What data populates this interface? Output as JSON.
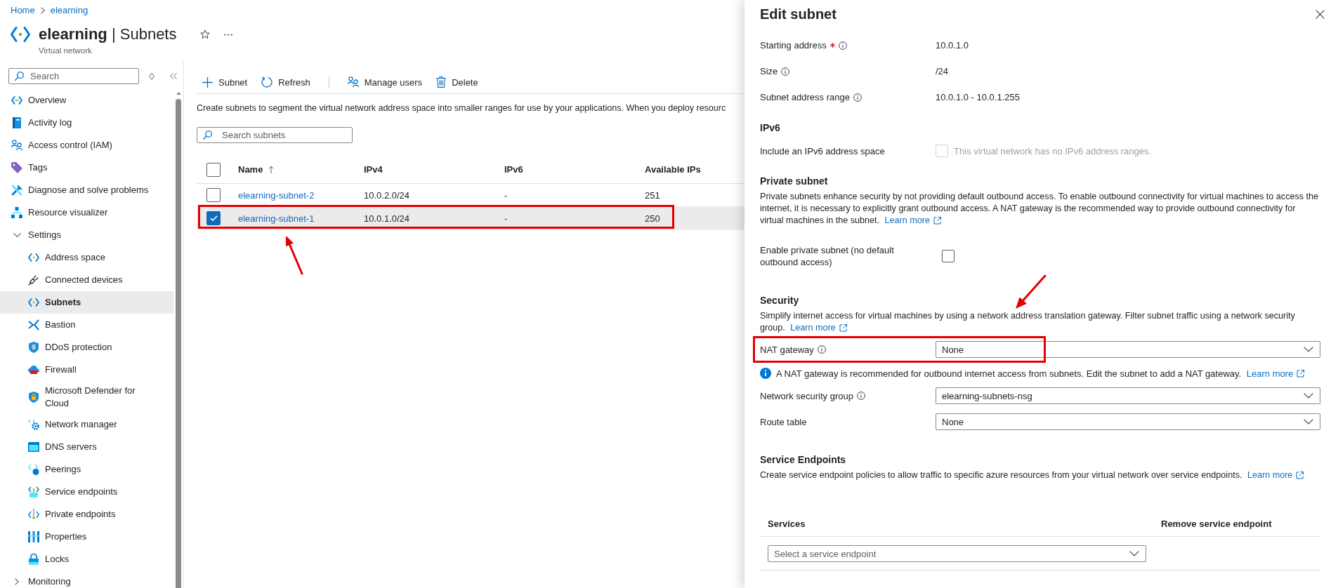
{
  "breadcrumb": [
    {
      "label": "Home"
    },
    {
      "label": "elearning"
    }
  ],
  "header": {
    "title": "**elearning** | Subnets",
    "subtitle": "Virtual network"
  },
  "sidebar": {
    "search": {
      "placeholder": "Search"
    },
    "items": [
      {
        "kind": "page",
        "label": "Overview",
        "selected": false
      },
      {
        "kind": "page",
        "label": "Activity log",
        "selected": false
      },
      {
        "kind": "page",
        "label": "Access control (IAM)",
        "selected": false
      },
      {
        "kind": "page",
        "label": "Tags",
        "selected": false
      },
      {
        "kind": "page",
        "label": "Diagnose and solve problems",
        "selected": false
      },
      {
        "kind": "page",
        "label": "Resource visualizer",
        "selected": false
      },
      {
        "kind": "group",
        "label": "Settings",
        "selected": false,
        "expanded": true,
        "children": [
          {
            "kind": "page",
            "label": "Address space",
            "selected": false
          },
          {
            "kind": "page",
            "label": "Connected devices",
            "selected": false
          },
          {
            "kind": "page",
            "label": "Subnets",
            "selected": true
          },
          {
            "kind": "page",
            "label": "Bastion",
            "selected": false
          },
          {
            "kind": "page",
            "label": "DDoS protection",
            "selected": false
          },
          {
            "kind": "page",
            "label": "Firewall",
            "selected": false
          },
          {
            "kind": "page",
            "label": "Microsoft Defender for Cloud",
            "selected": false
          },
          {
            "kind": "page",
            "label": "Network manager",
            "selected": false
          },
          {
            "kind": "page",
            "label": "DNS servers",
            "selected": false
          },
          {
            "kind": "page",
            "label": "Peerings",
            "selected": false
          },
          {
            "kind": "page",
            "label": "Service endpoints",
            "selected": false
          },
          {
            "kind": "page",
            "label": "Private endpoints",
            "selected": false
          },
          {
            "kind": "page",
            "label": "Properties",
            "selected": false
          },
          {
            "kind": "page",
            "label": "Locks",
            "selected": false
          }
        ]
      },
      {
        "kind": "group",
        "label": "Monitoring",
        "selected": false,
        "expanded": false
      }
    ]
  },
  "toolbar": {
    "groups": [
      [
        {
          "label": "Subnet"
        },
        {
          "label": "Refresh"
        }
      ],
      [
        {
          "label": "Manage users"
        },
        {
          "label": "Delete"
        }
      ]
    ]
  },
  "description": "Create subnets to segment the virtual network address space into smaller ranges for use by your applications. When you deploy resourc",
  "search": {
    "placeholder": "Search subnets"
  },
  "table": {
    "select_all": {
      "checked": false
    },
    "columns": [
      {
        "label": "Name",
        "sorted": true
      },
      {
        "label": "IPv4",
        "sorted": false
      },
      {
        "label": "IPv6",
        "sorted": false
      },
      {
        "label": "Available IPs",
        "sorted": false
      }
    ],
    "rows": [
      {
        "selected": false,
        "cells": [
          "elearning-subnet-2",
          "10.0.2.0/24",
          "-",
          "251"
        ]
      },
      {
        "selected": true,
        "cells": [
          "elearning-subnet-1",
          "10.0.1.0/24",
          "-",
          "250"
        ]
      }
    ]
  },
  "panel": {
    "title": "Edit subnet",
    "fields": [
      {
        "label": "Starting address",
        "required": true,
        "info": true,
        "value": "10.0.1.0"
      },
      {
        "label": "Size",
        "required": false,
        "info": true,
        "value": "/24"
      },
      {
        "label": "Subnet address range",
        "required": false,
        "info": true,
        "value": "10.0.1.0 - 10.0.1.255"
      }
    ],
    "ipv6": {
      "heading": "IPv6",
      "label": "Include an IPv6 address space",
      "checked": false,
      "disabled": true,
      "note": "This virtual network has no IPv6 address ranges."
    },
    "private_subnet": {
      "heading": "Private subnet",
      "text": "Private subnets enhance security by not providing default outbound access. To enable outbound connectivity for virtual machines to access the internet, it is necessary to explicitly grant outbound access. A NAT gateway is the recommended way to provide outbound connectivity for virtual machines in the subnet.",
      "link": "Learn more",
      "label": "Enable private subnet (no default outbound access)",
      "checked": false
    },
    "security": {
      "heading": "Security",
      "text": "Simplify internet access for virtual machines by using a network address translation gateway. Filter subnet traffic using a network security group.",
      "link": "Learn more",
      "items": [
        {
          "kind": "select",
          "label": "NAT gateway",
          "info": true,
          "value": "None"
        },
        {
          "kind": "notice",
          "text": "A NAT gateway is recommended for outbound internet access from subnets. Edit the subnet to add a NAT gateway.",
          "link": "Learn more"
        },
        {
          "kind": "select",
          "label": "Network security group",
          "info": true,
          "value": "elearning-subnets-nsg"
        },
        {
          "kind": "select",
          "label": "Route table",
          "info": false,
          "value": "None"
        }
      ]
    },
    "service_endpoints": {
      "heading": "Service Endpoints",
      "text": "Create service endpoint policies to allow traffic to specific azure resources from your virtual network over service endpoints.",
      "link": "Learn more",
      "columns": [
        {
          "label": "Services"
        },
        {
          "label": "Remove service endpoint"
        }
      ],
      "select": {
        "placeholder": "Select a service endpoint"
      }
    }
  }
}
